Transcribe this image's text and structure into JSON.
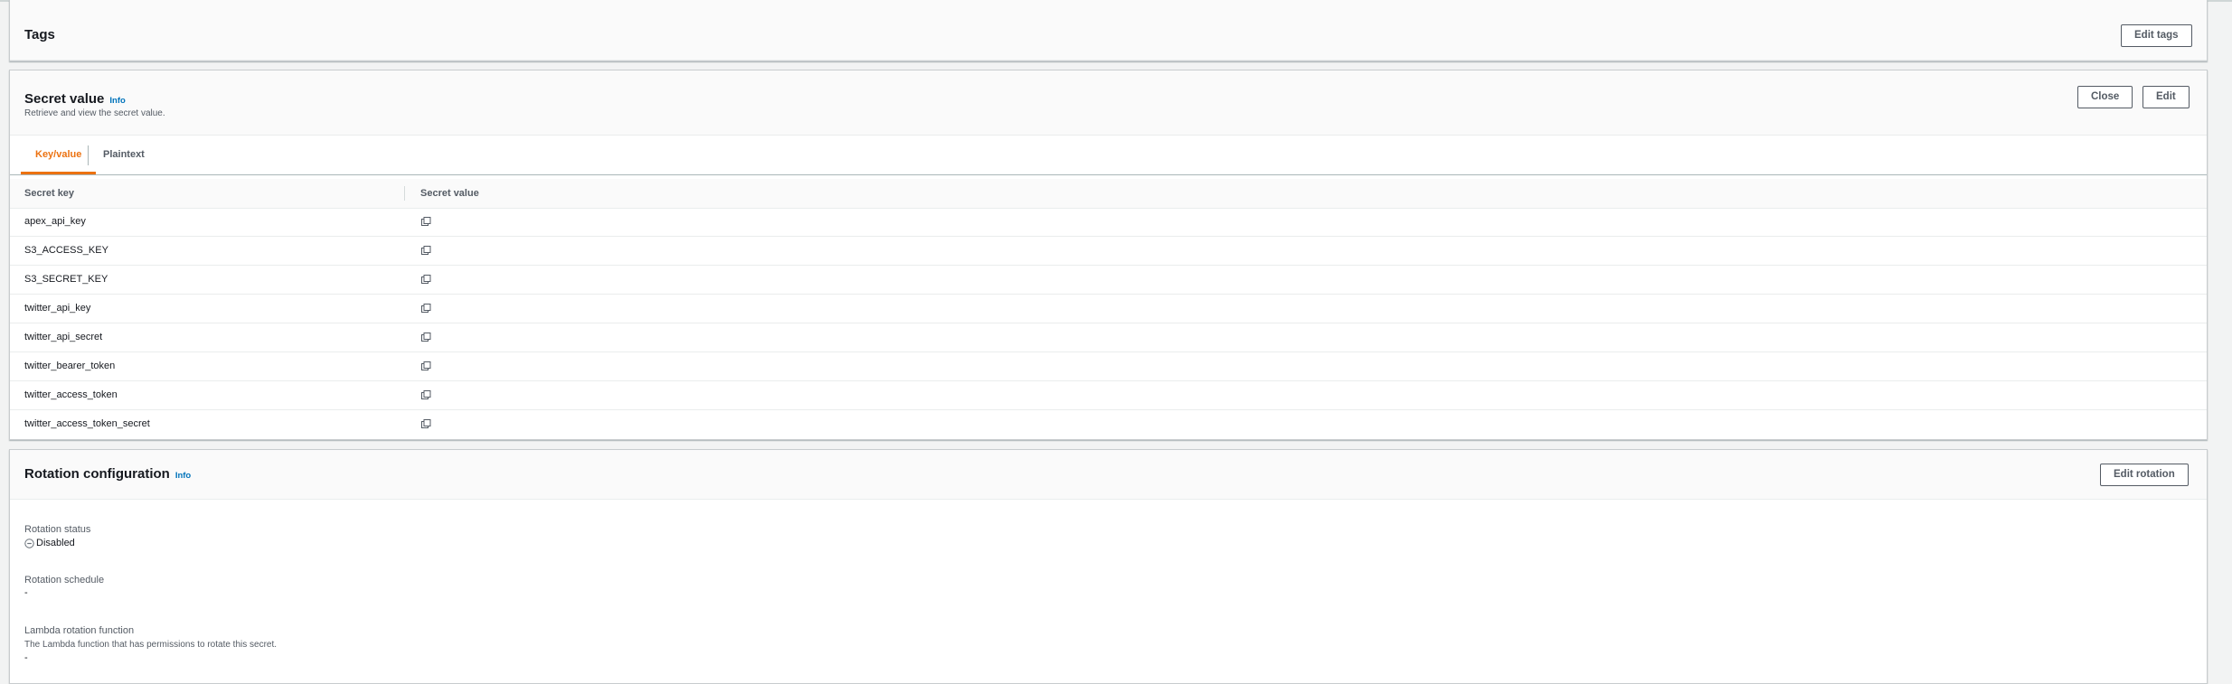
{
  "tags": {
    "title": "Tags",
    "edit_button": "Edit tags"
  },
  "secret_value": {
    "title": "Secret value",
    "info": "Info",
    "description": "Retrieve and view the secret value.",
    "close_button": "Close",
    "edit_button": "Edit",
    "tabs": [
      {
        "label": "Key/value",
        "active": true
      },
      {
        "label": "Plaintext",
        "active": false
      }
    ],
    "columns": [
      "Secret key",
      "Secret value"
    ],
    "rows": [
      {
        "key": "apex_api_key"
      },
      {
        "key": "S3_ACCESS_KEY"
      },
      {
        "key": "S3_SECRET_KEY"
      },
      {
        "key": "twitter_api_key"
      },
      {
        "key": "twitter_api_secret"
      },
      {
        "key": "twitter_bearer_token"
      },
      {
        "key": "twitter_access_token"
      },
      {
        "key": "twitter_access_token_secret"
      }
    ]
  },
  "rotation": {
    "title": "Rotation configuration",
    "info": "Info",
    "edit_button": "Edit rotation",
    "status_label": "Rotation status",
    "status_value": "Disabled",
    "schedule_label": "Rotation schedule",
    "schedule_value": "-",
    "lambda_label": "Lambda rotation function",
    "lambda_description": "The Lambda function that has permissions to rotate this secret.",
    "lambda_value": "-"
  },
  "colors": {
    "accent": "#ec7211",
    "link": "#0073bb",
    "border": "#c8ccce"
  },
  "icons": [
    "copy-icon",
    "disabled-status-icon"
  ]
}
